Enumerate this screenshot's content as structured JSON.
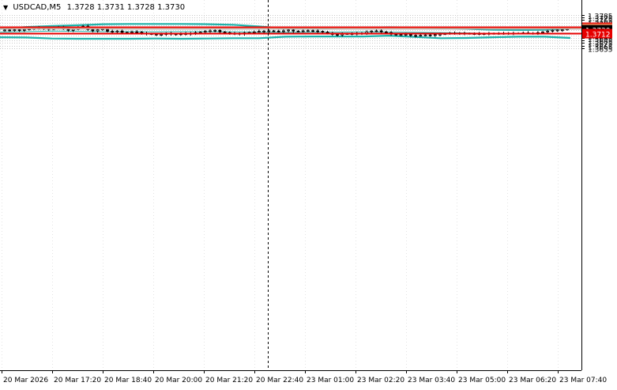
{
  "header": {
    "symbol": "USDCAD,M5",
    "ohlc": "1.3728 1.3731 1.3728 1.3730",
    "menu_icon": "triangle-down-icon"
  },
  "price_axis": {
    "ticks": [
      "1.3785",
      "1.3775",
      "1.3765",
      "1.3755",
      "1.3745",
      "1.3735",
      "1.3725",
      "1.3715",
      "1.3705",
      "1.3695",
      "1.3685",
      "1.3675",
      "1.3665",
      "1.3655"
    ]
  },
  "time_axis": {
    "labels": [
      "20 Mar 2026",
      "20 Mar 17:20",
      "20 Mar 18:40",
      "20 Mar 20:00",
      "20 Mar 21:20",
      "20 Mar 22:40",
      "23 Mar 01:00",
      "23 Mar 02:20",
      "23 Mar 03:40",
      "23 Mar 05:00",
      "23 Mar 06:20",
      "23 Mar 07:40"
    ]
  },
  "price_labels": {
    "resistance": "1.3737",
    "ask": "1.3733",
    "current": "1.3730",
    "support": "1.3712"
  },
  "colors": {
    "level_line": "#e60000",
    "bollinger": "#20b2aa",
    "candle": "#000000",
    "ask_label": "#f07850",
    "current_label": "#000000",
    "session_separator": "#000000"
  },
  "chart_data": {
    "type": "candlestick",
    "symbol": "USDCAD",
    "timeframe": "M5",
    "ylim": [
      1.365,
      1.3792
    ],
    "levels": {
      "resistance": 1.3737,
      "support": 1.3712,
      "ask": 1.3733,
      "last": 1.373
    },
    "session_separator": "20 Mar 22:40",
    "bollinger_upper": [
      1.3732,
      1.3738,
      1.3742,
      1.3745,
      1.3749,
      1.375,
      1.375,
      1.375,
      1.3749,
      1.3747,
      1.374,
      1.3733,
      1.3733,
      1.3735,
      1.3736,
      1.3737,
      1.3736,
      1.3734,
      1.3731,
      1.3727,
      1.3726,
      1.3727,
      1.3733
    ],
    "bollinger_mid": [
      1.3718,
      1.372,
      1.3722,
      1.3721,
      1.372,
      1.372,
      1.3719,
      1.372,
      1.372,
      1.3719,
      1.3718,
      1.3717,
      1.3718,
      1.3718,
      1.3719,
      1.3718,
      1.3717,
      1.3716,
      1.3715,
      1.3713,
      1.3713,
      1.3713,
      1.3714
    ],
    "bollinger_lower": [
      1.3698,
      1.3697,
      1.3693,
      1.3692,
      1.3692,
      1.3692,
      1.3693,
      1.3692,
      1.3693,
      1.3694,
      1.3694,
      1.37,
      1.3701,
      1.3701,
      1.3701,
      1.3704,
      1.3699,
      1.3694,
      1.3695,
      1.3698,
      1.37,
      1.37,
      1.3695
    ],
    "closes": [
      1.3726,
      1.3725,
      1.3727,
      1.3725,
      1.3728,
      1.373,
      1.3733,
      1.3735,
      1.3732,
      1.3729,
      1.3737,
      1.3736,
      1.3731,
      1.3725,
      1.3729,
      1.3738,
      1.3741,
      1.3728,
      1.3723,
      1.3727,
      1.3731,
      1.3721,
      1.3719,
      1.3722,
      1.3717,
      1.3716,
      1.3719,
      1.3718,
      1.3714,
      1.3712,
      1.371,
      1.3707,
      1.3709,
      1.3713,
      1.3711,
      1.3708,
      1.3712,
      1.371,
      1.3714,
      1.3716,
      1.3718,
      1.3721,
      1.3723,
      1.3725,
      1.3719,
      1.3716,
      1.3712,
      1.3713,
      1.3711,
      1.3715,
      1.3717,
      1.3719,
      1.3721,
      1.3722,
      1.3723,
      1.3722,
      1.3721,
      1.3723,
      1.3726,
      1.3722,
      1.3721,
      1.3723,
      1.3724,
      1.3723,
      1.3721,
      1.3718,
      1.3713,
      1.3709,
      1.3707,
      1.3711,
      1.3712,
      1.371,
      1.3713,
      1.3714,
      1.3719,
      1.3722,
      1.3723,
      1.3719,
      1.3716,
      1.371,
      1.3707,
      1.3708,
      1.3709,
      1.3705,
      1.3704,
      1.3706,
      1.3707,
      1.3705,
      1.3708,
      1.371,
      1.3712,
      1.3714,
      1.3713,
      1.3714,
      1.3713,
      1.3712,
      1.3711,
      1.3712,
      1.3712,
      1.3713,
      1.3712,
      1.3713,
      1.3713,
      1.3714,
      1.3713,
      1.3714,
      1.3715,
      1.3714,
      1.3714,
      1.3716,
      1.3719,
      1.3722,
      1.3725,
      1.3726,
      1.3727,
      1.373
    ]
  }
}
